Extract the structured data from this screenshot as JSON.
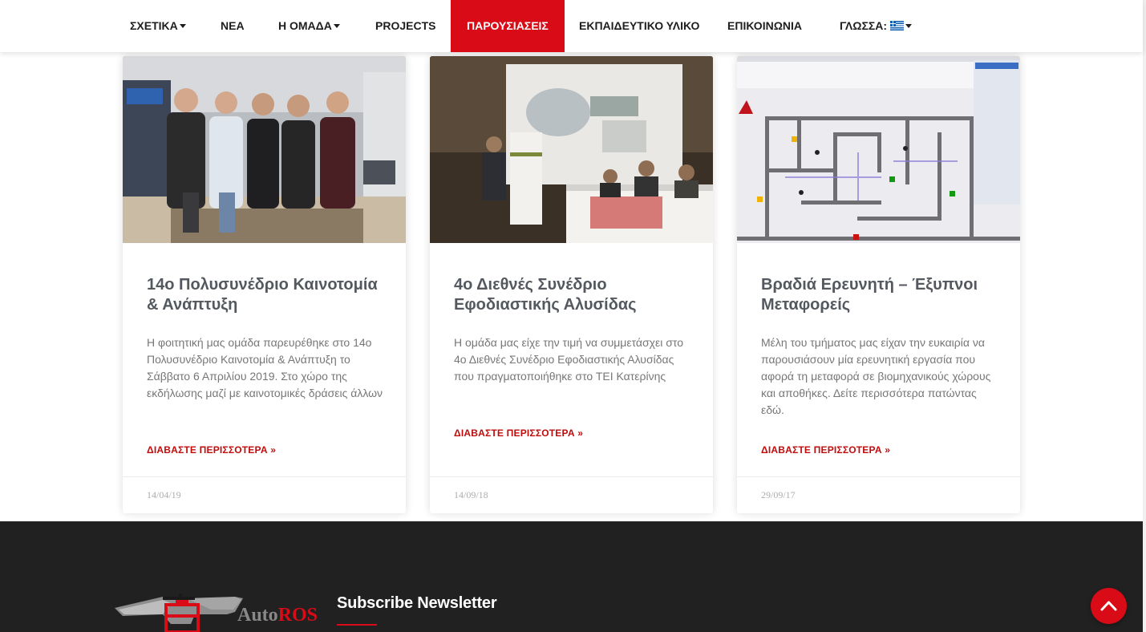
{
  "nav": {
    "items": [
      {
        "label": "ΣΧΕΤΙΚΑ",
        "dropdown": true
      },
      {
        "label": "ΝΕΑ",
        "dropdown": false
      },
      {
        "label": "Η ΟΜΑΔΑ",
        "dropdown": true
      },
      {
        "label": "PROJECTS",
        "dropdown": false
      },
      {
        "label": "ΠΑΡΟΥΣΙΑΣΕΙΣ",
        "dropdown": false,
        "active": true
      },
      {
        "label": "ΕΚΠΑΙΔΕΥΤΙΚΟ ΥΛΙΚΟ",
        "dropdown": false
      },
      {
        "label": "ΕΠΙΚΟΙΝΩΝΙΑ",
        "dropdown": false
      }
    ],
    "language_label": "ΓΛΩΣΣΑ:",
    "language_icon": "greek-flag-icon"
  },
  "posts": [
    {
      "title": "14ο Πολυσυνέδριο Καινοτομία & Ανάπτυξη",
      "excerpt": "Η φοιτητική μας ομάδα παρευρέθηκε στο 14ο Πολυσυνέδριο Καινοτομία & Ανάπτυξη το Σάββατο 6 Απριλίου 2019. Στο χώρο της εκδήλωσης μαζί με καινοτομικές δράσεις άλλων",
      "read_more": "ΔΙΑΒΑΣΤΕ ΠΕΡΙΣΣΟΤΕΡΑ »",
      "date": "14/04/19",
      "image": "team-photo"
    },
    {
      "title": "4ο Διεθνές Συνέδριο Εφοδιαστικής Αλυσίδας",
      "excerpt": "Η ομάδα μας είχε την τιμή να συμμετάσχει στο 4ο Διεθνές Συνέδριο Εφοδιαστικής Αλυσίδας που πραγματοποιήθηκε στο ΤΕΙ Κατερίνης",
      "read_more": "ΔΙΑΒΑΣΤΕ ΠΕΡΙΣΣΟΤΕΡΑ »",
      "date": "14/09/18",
      "image": "conference-photo"
    },
    {
      "title": "Βραδιά Ερευνητή – Έξυπνοι Μεταφορείς",
      "excerpt": "Μέλη του τμήματος μας είχαν την ευκαιρία να παρουσιάσουν μία ερευνητική εργασία που αφορά τη μεταφορά σε βιομηχανικούς χώρους και αποθήκες. Δείτε περισσότερα πατώντας εδώ.",
      "read_more": "ΔΙΑΒΑΣΤΕ ΠΕΡΙΣΣΟΤΕΡΑ »",
      "date": "29/09/17",
      "image": "simulation-screenshot"
    }
  ],
  "footer": {
    "logo_text_auto": "Auto",
    "logo_text_ros": "ROS",
    "newsletter_title": "Subscribe Newsletter"
  },
  "colors": {
    "accent": "#d90b16",
    "footer_bg": "#212121"
  },
  "icons": {
    "scroll_top": "chevron-up-icon"
  }
}
